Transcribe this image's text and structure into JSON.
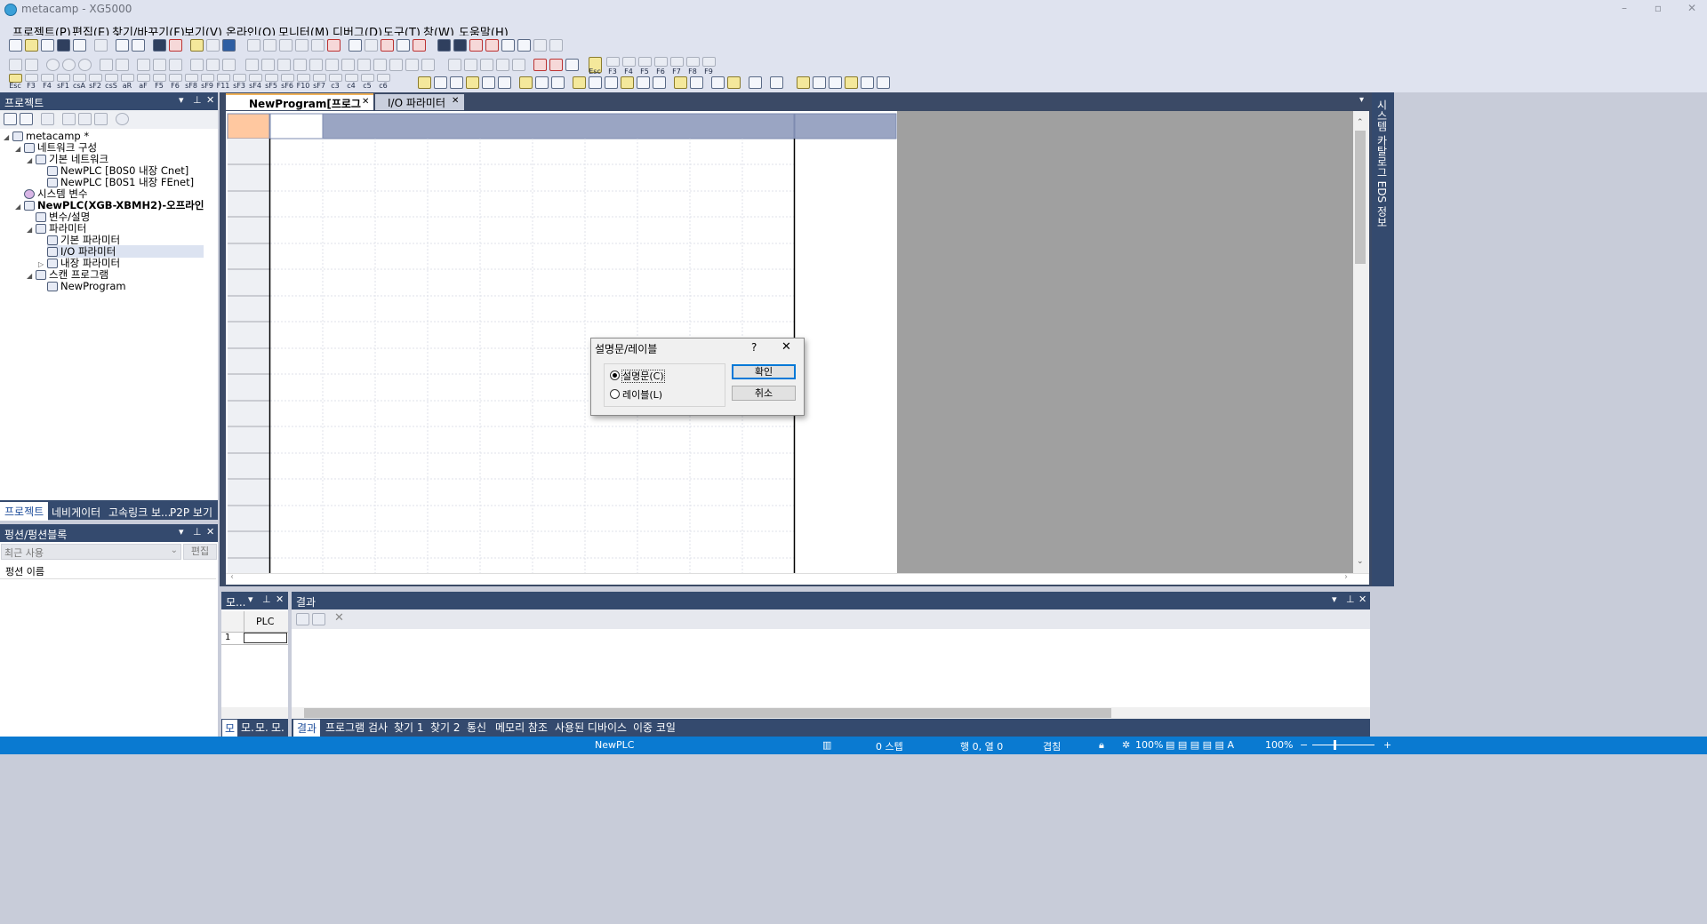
{
  "window": {
    "title": "metacamp - XG5000"
  },
  "menu": [
    "프로젝트(P)",
    "편집(E)",
    "찾기/바꾸기(F)",
    "보기(V)",
    "온라인(O)",
    "모니터(M)",
    "디버그(D)",
    "도구(T)",
    "창(W)",
    "도움말(H)"
  ],
  "toolbar3_labels": [
    "Esc",
    "F3",
    "F4",
    "sF1",
    "csA",
    "sF2",
    "csS",
    "aR",
    "aF",
    "F5",
    "F6",
    "sF8",
    "sF9",
    "F11",
    "sF3",
    "sF4",
    "sF5",
    "sF6",
    "F10",
    "sF7",
    "c3",
    "c4",
    "c5",
    "c6"
  ],
  "toolbar2_labels": [
    "Esc",
    "F3",
    "F4",
    "F5",
    "F6",
    "F7",
    "F8",
    "F9"
  ],
  "project_panel": {
    "title": "프로젝트",
    "tree": [
      {
        "label": "metacamp *",
        "level": 0
      },
      {
        "label": "네트워크 구성",
        "level": 1
      },
      {
        "label": "기본 네트워크",
        "level": 2
      },
      {
        "label": "NewPLC [B0S0 내장 Cnet]",
        "level": 3
      },
      {
        "label": "NewPLC [B0S1 내장 FEnet]",
        "level": 3
      },
      {
        "label": "시스템 변수",
        "level": 1
      },
      {
        "label": "NewPLC(XGB-XBMH2)-오프라인",
        "level": 1
      },
      {
        "label": "변수/설명",
        "level": 2
      },
      {
        "label": "파라미터",
        "level": 2
      },
      {
        "label": "기본 파라미터",
        "level": 3
      },
      {
        "label": "I/O 파라미터",
        "level": 3
      },
      {
        "label": "내장 파라미터",
        "level": 3
      },
      {
        "label": "스캔 프로그램",
        "level": 2
      },
      {
        "label": "NewProgram",
        "level": 3
      }
    ],
    "tabs": [
      "프로젝트",
      "네비게이터",
      "고속링크 보...",
      "P2P 보기"
    ]
  },
  "function_panel": {
    "title": "펑션/펑션블록",
    "recent": "최근 사용",
    "edit_button": "편집",
    "column": "펑션 이름"
  },
  "editor_tabs": [
    {
      "label": "NewProgram[프로그램]",
      "active": true
    },
    {
      "label": "I/O 파라미터",
      "active": false
    }
  ],
  "right_side_text": "시스템 카탈로그 EDS 정보",
  "dialog": {
    "title": "설명문/레이블",
    "help": "?",
    "options": [
      {
        "label": "설명문(C)",
        "selected": true
      },
      {
        "label": "레이블(L)",
        "selected": false
      }
    ],
    "ok": "확인",
    "cancel": "취소"
  },
  "monitor_panel": {
    "title": "모...",
    "column": "PLC",
    "row": "1",
    "tabs": [
      "모",
      "모.",
      "모.",
      "모."
    ]
  },
  "result_panel": {
    "title": "결과",
    "tabs": [
      "결과",
      "프로그램 검사",
      "찾기 1",
      "찾기 2",
      "통신",
      "메모리 참조",
      "사용된 디바이스",
      "이중 코일"
    ]
  },
  "status": {
    "plc": "NewPLC",
    "step": "0 스텝",
    "position": "행 0, 열 0",
    "mode": "겹침",
    "zoom1": "100%",
    "zoom2": "100%"
  },
  "colors": {
    "panel_header": "#344a6e",
    "status_bar": "#0a7ad1",
    "editor_header": "#9aa5c3",
    "editor_cursor": "#ffc8a0"
  }
}
